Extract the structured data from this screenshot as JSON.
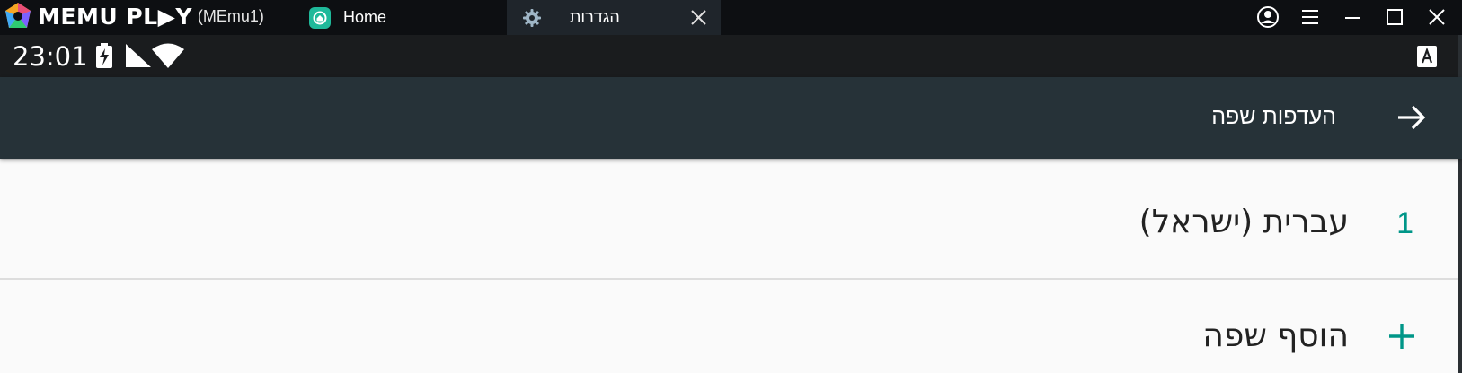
{
  "emulator": {
    "brand": "MEMU PL▶Y",
    "instance": "(MEmu1)",
    "tabs": [
      {
        "label": "Home",
        "icon": "home-icon"
      },
      {
        "label": "הגדרות",
        "icon": "gear-icon",
        "active": true
      }
    ],
    "window_controls": [
      "account-icon",
      "menu-icon",
      "minimize-icon",
      "maximize-icon",
      "close-icon"
    ]
  },
  "statusbar": {
    "time": "23:01",
    "icons": [
      "battery-charging-icon",
      "cellular-signal-icon",
      "wifi-icon",
      "keyboard-a-icon"
    ]
  },
  "toolbar": {
    "title": "העדפות שפה",
    "back_icon": "arrow-back-icon",
    "background": "#263238"
  },
  "languages": [
    {
      "index": "1",
      "name": "עברית (ישראל)"
    }
  ],
  "add_language": {
    "label": "הוסף שפה",
    "icon": "plus-icon"
  },
  "colors": {
    "accent": "#009688",
    "titlebar": "#0d0f12",
    "statusbar": "#1a1c1e"
  }
}
